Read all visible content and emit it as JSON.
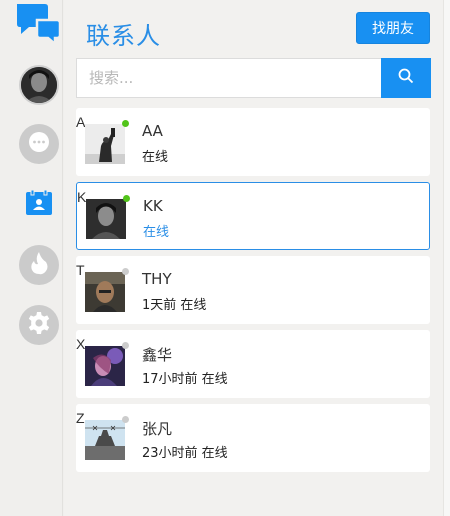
{
  "sidebar": {
    "logo_icon": "chat-bubbles-icon",
    "items": [
      {
        "name": "avatar",
        "icon": "user-avatar"
      },
      {
        "name": "messages",
        "icon": "chat-dots-icon"
      },
      {
        "name": "contacts",
        "icon": "contacts-card-icon",
        "active": true
      },
      {
        "name": "discover",
        "icon": "flame-icon"
      },
      {
        "name": "settings",
        "icon": "gear-icon"
      }
    ]
  },
  "header": {
    "title": "联系人",
    "find_friend_label": "找朋友"
  },
  "search": {
    "placeholder": "搜索...",
    "value": "",
    "button_icon": "search-icon"
  },
  "contacts": [
    {
      "letter": "A",
      "name": "AA",
      "status": "在线",
      "online": true
    },
    {
      "letter": "K",
      "name": "KK",
      "status": "在线",
      "online": true,
      "selected": true
    },
    {
      "letter": "T",
      "name": "THY",
      "status": "1天前 在线",
      "online": false
    },
    {
      "letter": "X",
      "name": "鑫华",
      "status": "17小时前 在线",
      "online": false
    },
    {
      "letter": "Z",
      "name": "张凡",
      "status": "23小时前 在线",
      "online": false
    }
  ],
  "colors": {
    "accent": "#1890f2",
    "title": "#2a8ee6",
    "online_dot": "#52c41a",
    "offline_dot": "#cccccc"
  }
}
